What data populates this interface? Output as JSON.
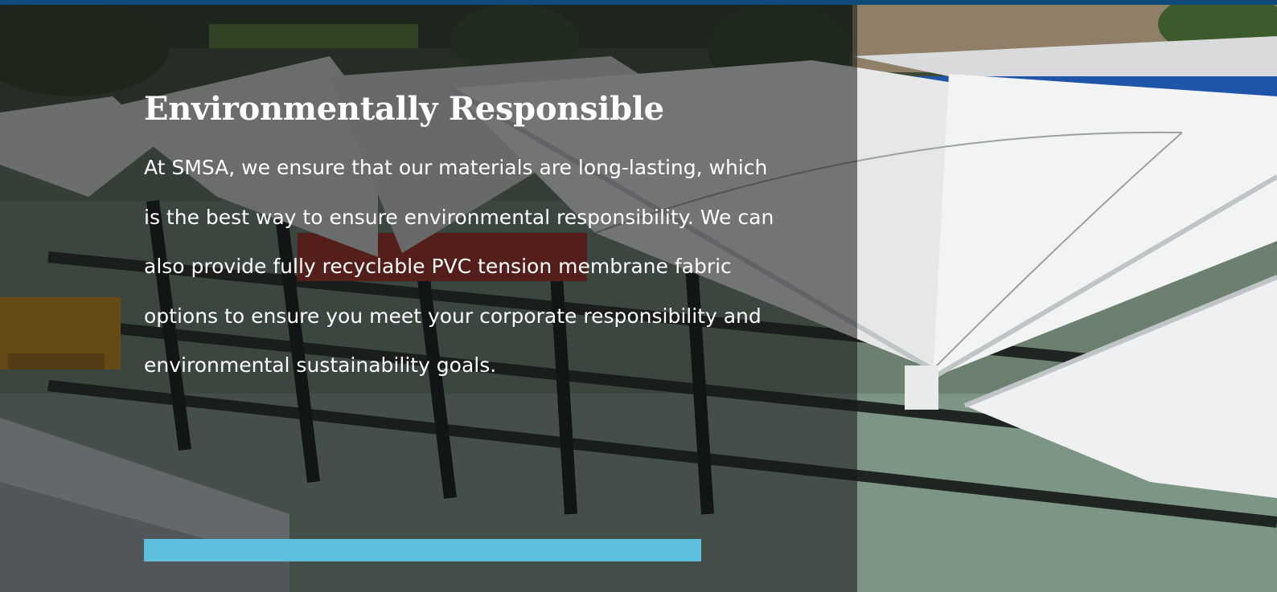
{
  "section": {
    "title": "Environmentally Responsible",
    "body": "At SMSA, we ensure that our materials are long-lasting, which is the best way to ensure environmental responsibility. We can also provide fully recyclable PVC tension membrane fabric options to ensure you meet your corporate responsibility and environmental sustainability goals."
  },
  "colors": {
    "top_bar": "#0e4a7a",
    "accent_bar": "#5cc0dd",
    "text": "#ffffff"
  }
}
